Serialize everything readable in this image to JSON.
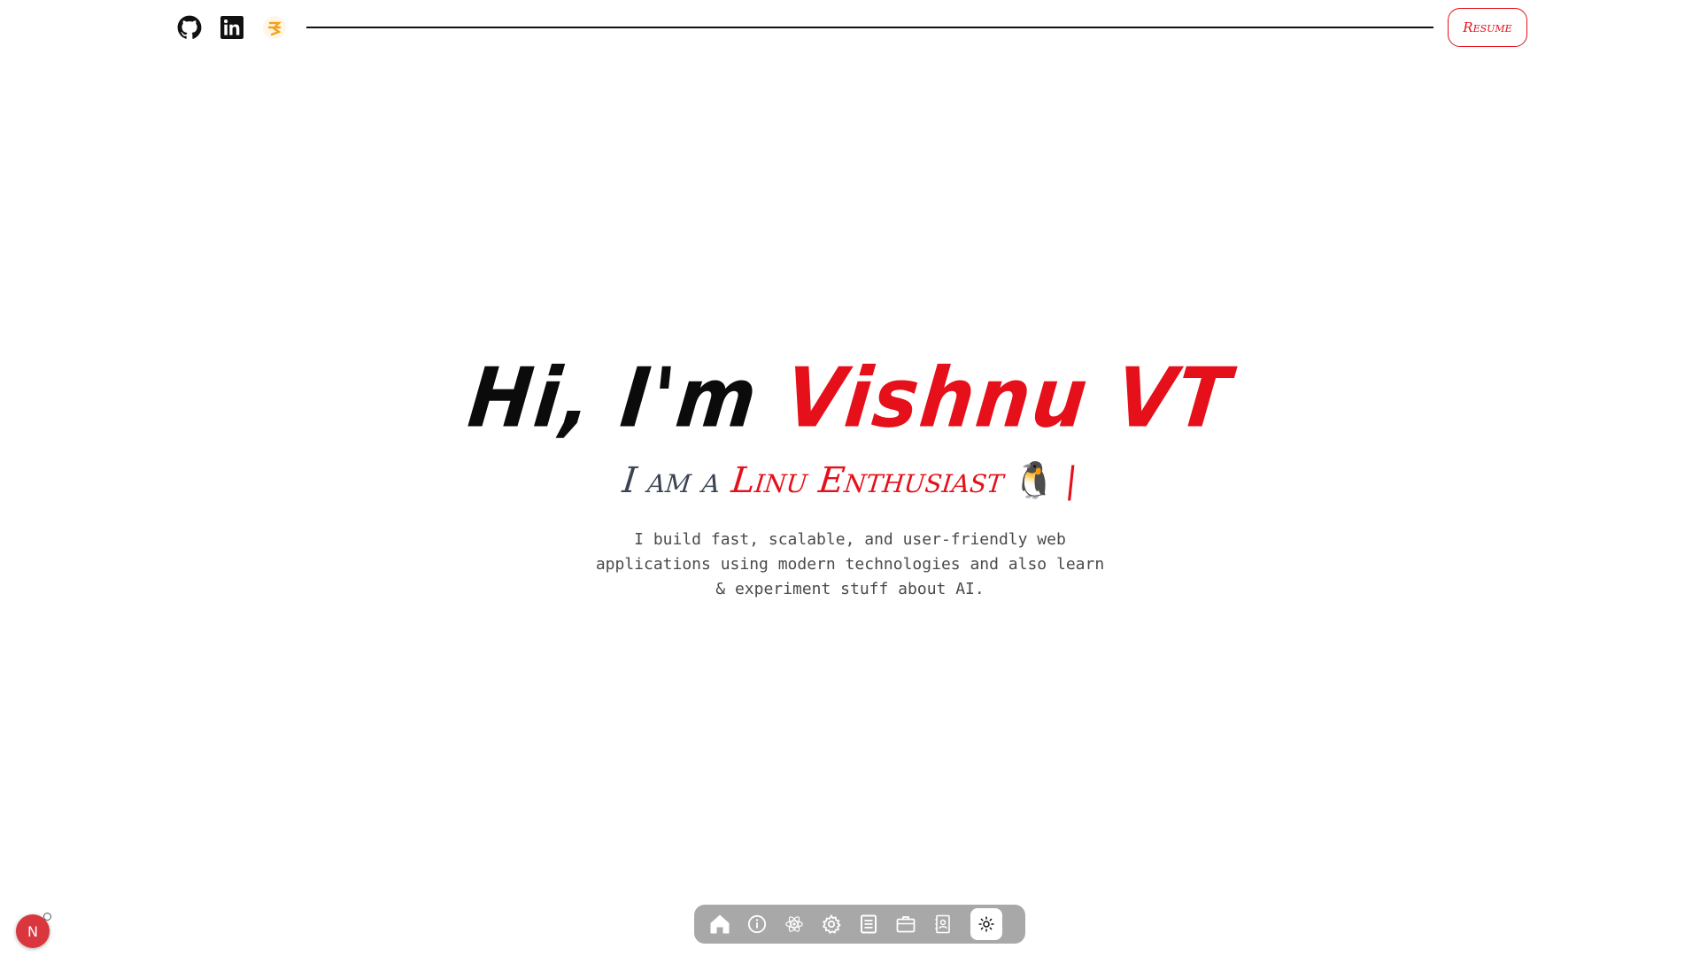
{
  "header": {
    "social": [
      {
        "name": "github-icon"
      },
      {
        "name": "linkedin-icon"
      },
      {
        "name": "portfolio-logo-icon"
      }
    ],
    "resume_label": "Resume"
  },
  "hero": {
    "greeting": "Hi, I'm ",
    "name": "Vishnu VT",
    "sub_prefix": "I am a ",
    "role": "Linu Enthusiast",
    "emoji": "🐧",
    "cursor": "|",
    "description": "I build fast, scalable, and user-friendly web applications using modern technologies and also learn & experiment stuff about AI."
  },
  "dock": {
    "items": [
      {
        "icon": "home-icon"
      },
      {
        "icon": "info-icon"
      },
      {
        "icon": "react-icon"
      },
      {
        "icon": "gear-icon"
      },
      {
        "icon": "book-icon"
      },
      {
        "icon": "briefcase-icon"
      },
      {
        "icon": "contact-icon"
      },
      {
        "icon": "sun-icon",
        "active": true
      }
    ]
  },
  "badge": {
    "letter": "N"
  },
  "colors": {
    "accent": "#e5101a",
    "text": "#0b0b0b",
    "subtext": "#3b4453",
    "dock_bg": "#a8a8a8"
  }
}
